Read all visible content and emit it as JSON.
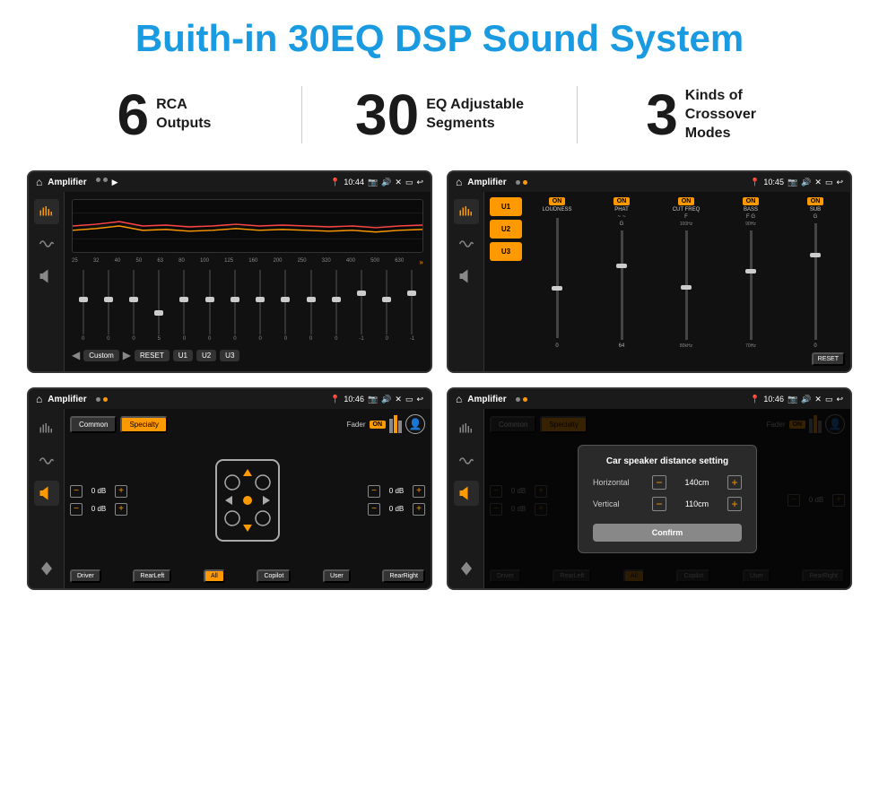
{
  "title": "Buith-in 30EQ DSP Sound System",
  "stats": [
    {
      "number": "6",
      "label": "RCA\nOutputs"
    },
    {
      "number": "30",
      "label": "EQ Adjustable\nSegments"
    },
    {
      "number": "3",
      "label": "Kinds of\nCrossover Modes"
    }
  ],
  "screen1": {
    "statusbar": {
      "title": "Amplifier",
      "time": "10:44",
      "icons": [
        "📍",
        "📷",
        "🔊",
        "✕",
        "▭",
        "↩"
      ]
    },
    "freqs": [
      "25",
      "32",
      "40",
      "50",
      "63",
      "80",
      "100",
      "125",
      "160",
      "200",
      "250",
      "320",
      "400",
      "500",
      "630"
    ],
    "sliderVals": [
      "0",
      "0",
      "0",
      "5",
      "0",
      "0",
      "0",
      "0",
      "0",
      "0",
      "0",
      "-1",
      "0",
      "-1"
    ],
    "bottomBtns": [
      "Custom",
      "RESET",
      "U1",
      "U2",
      "U3"
    ]
  },
  "screen2": {
    "statusbar": {
      "title": "Amplifier",
      "time": "10:45"
    },
    "presets": [
      "U1",
      "U2",
      "U3"
    ],
    "controls": [
      {
        "label": "LOUDNESS",
        "on": true
      },
      {
        "label": "PHAT",
        "on": true
      },
      {
        "label": "CUT FREQ",
        "on": true
      },
      {
        "label": "BASS",
        "on": true
      },
      {
        "label": "SUB",
        "on": true
      }
    ],
    "resetBtn": "RESET"
  },
  "screen3": {
    "statusbar": {
      "title": "Amplifier",
      "time": "10:46"
    },
    "modeBtns": [
      "Common",
      "Specialty"
    ],
    "faderLabel": "Fader",
    "onLabel": "ON",
    "dbRows": [
      "0 dB",
      "0 dB",
      "0 dB",
      "0 dB"
    ],
    "bottomBtns": [
      "Driver",
      "RearLeft",
      "All",
      "Copilot",
      "User",
      "RearRight"
    ]
  },
  "screen4": {
    "statusbar": {
      "title": "Amplifier",
      "time": "10:46"
    },
    "modeBtns": [
      "Common",
      "Specialty"
    ],
    "dialog": {
      "title": "Car speaker distance setting",
      "rows": [
        {
          "label": "Horizontal",
          "value": "140cm"
        },
        {
          "label": "Vertical",
          "value": "110cm"
        }
      ],
      "confirmBtn": "Confirm"
    },
    "dbRows": [
      "0 dB",
      "0 dB"
    ],
    "bottomBtns": [
      "Driver",
      "RearLeft",
      "All",
      "Copilot",
      "User",
      "RearRight"
    ]
  }
}
